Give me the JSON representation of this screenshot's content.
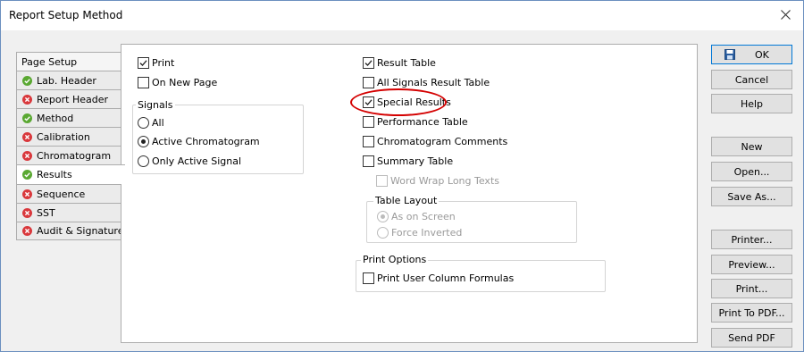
{
  "window": {
    "title": "Report Setup Method"
  },
  "tabs": [
    {
      "label": "Page Setup",
      "status": "none"
    },
    {
      "label": "Lab. Header",
      "status": "ok"
    },
    {
      "label": "Report Header",
      "status": "error"
    },
    {
      "label": "Method",
      "status": "ok"
    },
    {
      "label": "Calibration",
      "status": "error"
    },
    {
      "label": "Chromatogram",
      "status": "error"
    },
    {
      "label": "Results",
      "status": "ok",
      "selected": true
    },
    {
      "label": "Sequence",
      "status": "error"
    },
    {
      "label": "SST",
      "status": "error"
    },
    {
      "label": "Audit & Signatures",
      "status": "error"
    }
  ],
  "results": {
    "print": {
      "label": "Print",
      "checked": true
    },
    "on_new_page": {
      "label": "On New Page",
      "checked": false
    },
    "signals": {
      "title": "Signals",
      "all": "All",
      "active_chromatogram": "Active Chromatogram",
      "only_active_signal": "Only Active Signal",
      "selected": "active_chromatogram"
    },
    "result_table": {
      "label": "Result Table",
      "checked": true
    },
    "all_signals_result_table": {
      "label": "All Signals Result Table",
      "checked": false
    },
    "special_results": {
      "label": "Special Results",
      "checked": true
    },
    "performance_table": {
      "label": "Performance Table",
      "checked": false
    },
    "chromatogram_comments": {
      "label": "Chromatogram Comments",
      "checked": false
    },
    "summary_table": {
      "label": "Summary Table",
      "checked": false
    },
    "word_wrap": {
      "label": "Word Wrap Long Texts",
      "checked": false,
      "disabled": true
    },
    "table_layout": {
      "title": "Table Layout",
      "as_on_screen": "As on Screen",
      "force_inverted": "Force Inverted",
      "selected": "as_on_screen",
      "disabled": true
    },
    "print_options": {
      "title": "Print Options",
      "print_user_column_formulas": {
        "label": "Print User Column Formulas",
        "checked": false
      }
    }
  },
  "buttons": {
    "ok": "OK",
    "cancel": "Cancel",
    "help": "Help",
    "new": "New",
    "open": "Open...",
    "save_as": "Save As...",
    "printer": "Printer...",
    "preview": "Preview...",
    "print": "Print...",
    "print_to_pdf": "Print To PDF...",
    "send_pdf": "Send PDF"
  },
  "colors": {
    "status_ok": "#5aa832",
    "status_error": "#d9383c",
    "highlight_ring": "#d40000",
    "ok_button_border": "#0078d7",
    "save_icon": "#2a5d9f"
  }
}
